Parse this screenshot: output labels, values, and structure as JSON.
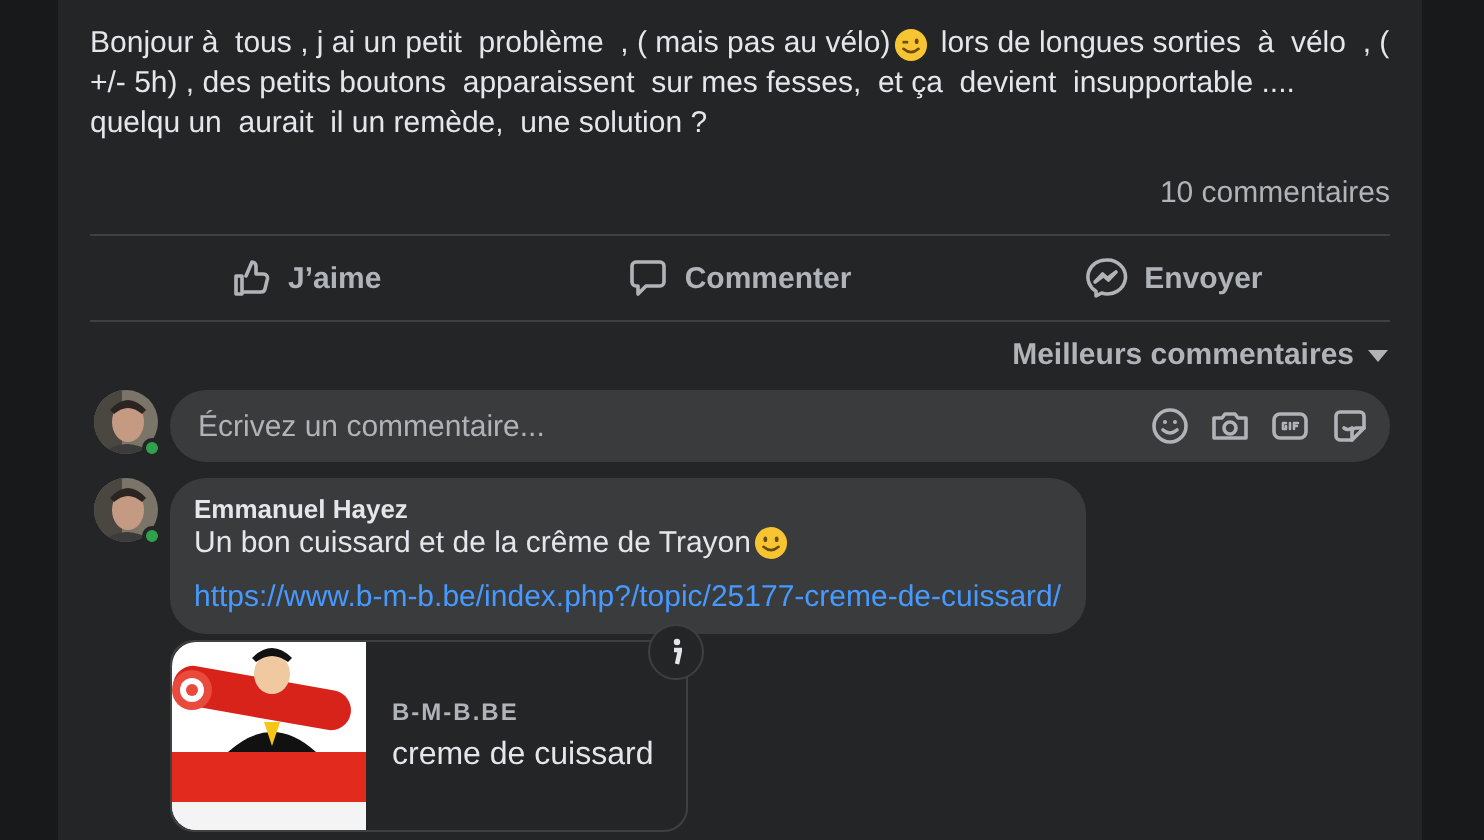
{
  "post": {
    "line_1_before_emoji": "Bonjour à  tous , j ai un petit  problème  , ( mais pas au vélo)",
    "line_1_after_emoji": "lors de longues sorties  à  vélo  , (",
    "line_2": "+/- 5h) , des petits boutons  apparaissent  sur mes fesses,  et ça  devient  insupportable ....",
    "line_3": "quelqu un  aurait  il un remède,  une solution ?",
    "comment_count": "10 commentaires"
  },
  "actions": [
    {
      "kind": "like",
      "label": "J’aime"
    },
    {
      "kind": "comment",
      "label": "Commenter"
    },
    {
      "kind": "send",
      "label": "Envoyer"
    }
  ],
  "sort": {
    "label": "Meilleurs commentaires"
  },
  "composer": {
    "placeholder": "Écrivez un commentaire...",
    "online": true
  },
  "comments": [
    {
      "author": "Emmanuel Hayez",
      "text": "Un bon cuissard et de la crême de Trayon",
      "online": true,
      "link": "https://www.b-m-b.be/index.php?/topic/25177-creme-de-cuissard/",
      "preview": {
        "domain": "B-M-B.BE",
        "title": "creme de cuissard"
      }
    }
  ]
}
